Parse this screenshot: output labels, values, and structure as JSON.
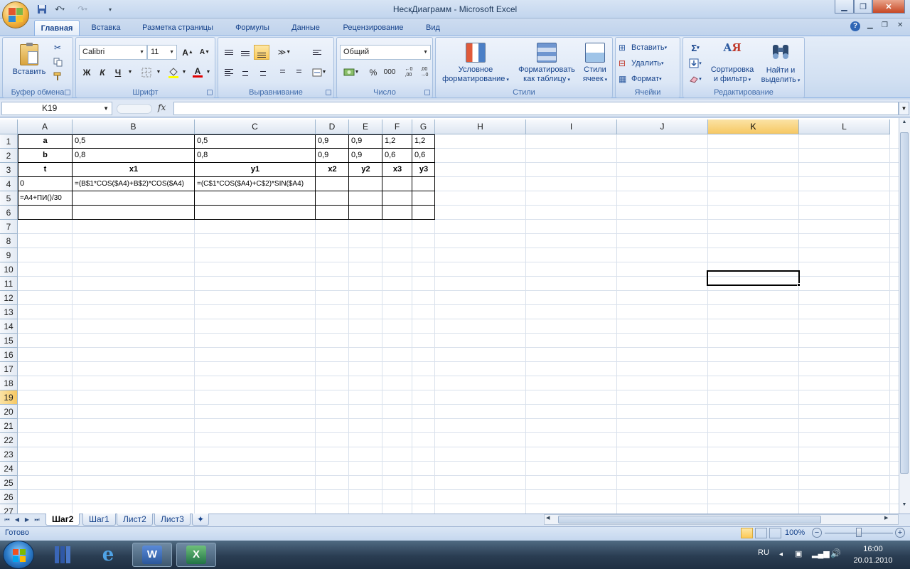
{
  "window": {
    "title": "НескДиаграмм - Microsoft Excel"
  },
  "qat": {
    "undo": "↶",
    "redo": "↷"
  },
  "ribbon_tabs": [
    "Главная",
    "Вставка",
    "Разметка страницы",
    "Формулы",
    "Данные",
    "Рецензирование",
    "Вид"
  ],
  "groups": {
    "clipboard": {
      "label": "Буфер обмена",
      "paste": "Вставить"
    },
    "font": {
      "label": "Шрифт",
      "font_name": "Calibri",
      "font_size": "11",
      "bold": "Ж",
      "italic": "К",
      "underline": "Ч"
    },
    "alignment": {
      "label": "Выравнивание"
    },
    "number": {
      "label": "Число",
      "format": "Общий",
      "percent": "%",
      "thousands": "000"
    },
    "styles": {
      "label": "Стили",
      "conditional_l1": "Условное",
      "conditional_l2": "форматирование",
      "as_table_l1": "Форматировать",
      "as_table_l2": "как таблицу",
      "cell_styles_l1": "Стили",
      "cell_styles_l2": "ячеек"
    },
    "cells": {
      "label": "Ячейки",
      "insert": "Вставить",
      "delete": "Удалить",
      "format": "Формат"
    },
    "editing": {
      "label": "Редактирование",
      "sort_l1": "Сортировка",
      "sort_l2": "и фильтр",
      "find_l1": "Найти и",
      "find_l2": "выделить"
    }
  },
  "formula_bar": {
    "name_box": "K19",
    "fx": "fx",
    "formula": ""
  },
  "columns": [
    "A",
    "B",
    "C",
    "D",
    "E",
    "F",
    "G",
    "H",
    "I",
    "J",
    "K",
    "L"
  ],
  "rows": [
    "1",
    "2",
    "3",
    "4",
    "5",
    "6",
    "7",
    "8",
    "9",
    "10",
    "11",
    "12",
    "13",
    "14",
    "15",
    "16",
    "17",
    "18",
    "19",
    "20",
    "21",
    "22",
    "23",
    "24",
    "25",
    "26",
    "27"
  ],
  "cells": {
    "A1": "a",
    "B1": "0,5",
    "C1": "0,5",
    "D1": "0,9",
    "E1": "0,9",
    "F1": "1,2",
    "G1": "1,2",
    "A2": "b",
    "B2": "0,8",
    "C2": "0,8",
    "D2": "0,9",
    "E2": "0,9",
    "F2": "0,6",
    "G2": "0,6",
    "A3": "t",
    "B3": "x1",
    "C3": "y1",
    "D3": "x2",
    "E3": "y2",
    "F3": "x3",
    "G3": "y3",
    "A4": "0",
    "B4": "=(B$1*COS($A4)+B$2)*COS($A4)",
    "C4": "=(C$1*COS($A4)+C$2)*SIN($A4)",
    "A5": "=A4+ПИ()/30"
  },
  "selected_cell": "K19",
  "sheet_tabs": [
    "Шаг2",
    "Шаг1",
    "Лист2",
    "Лист3"
  ],
  "active_sheet": "Шаг2",
  "status": {
    "text": "Готово",
    "zoom": "100%"
  },
  "taskbar": {
    "lang": "RU",
    "time": "16:00",
    "date": "20.01.2010"
  },
  "colors": {
    "ribbon_bg": "#dce7f6",
    "selected_header": "#f6c863",
    "title_text": "#1e395b",
    "accent": "#15428b"
  }
}
